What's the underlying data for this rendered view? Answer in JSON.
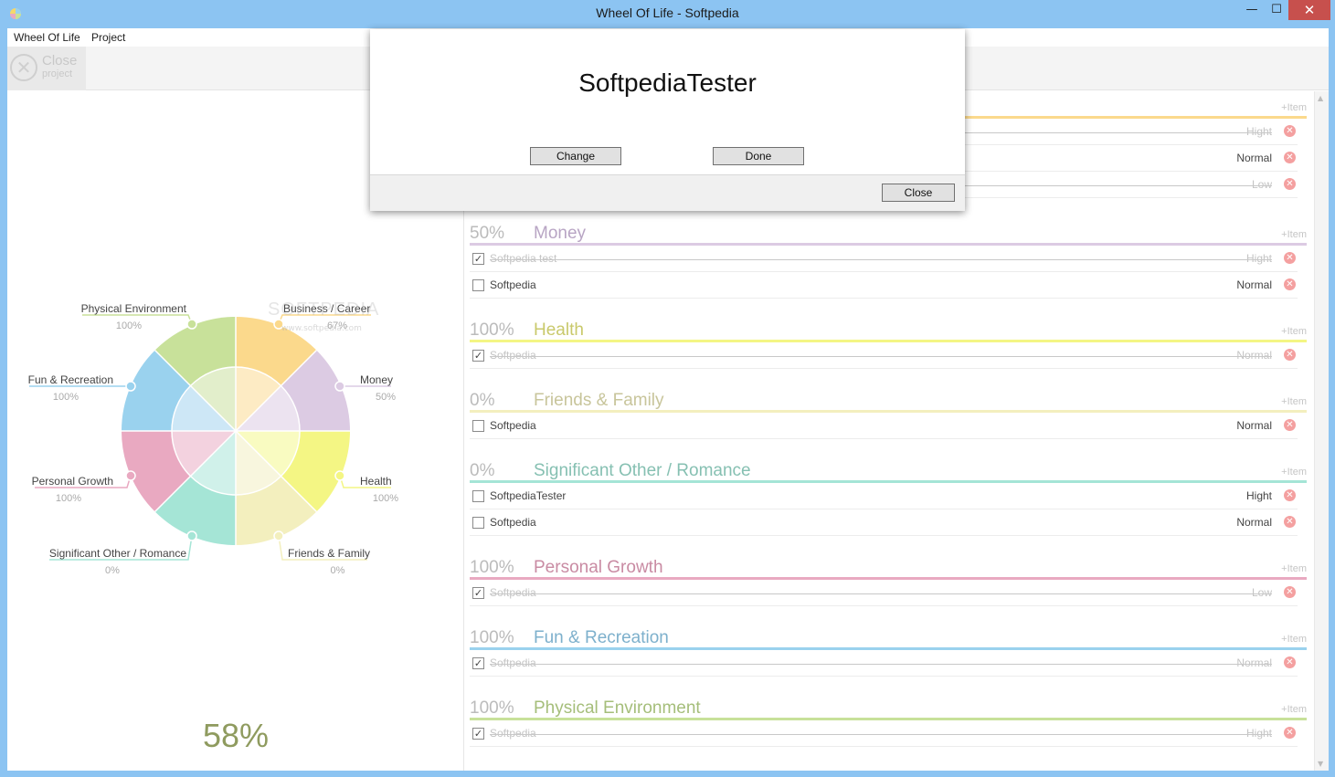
{
  "window": {
    "title": "Wheel Of Life - Softpedia",
    "minimize": "—",
    "maximize": "☐",
    "close": "✕"
  },
  "menu": [
    "Wheel Of Life",
    "Project"
  ],
  "toolbar": {
    "close_label": "Close",
    "close_sub": "project"
  },
  "wheel": {
    "total": "58%",
    "watermark": "SOFTPEDIA",
    "watermark_url": "www.softpedia.com",
    "segments": [
      {
        "name": "Business / Career",
        "pct": "67%",
        "value": 67,
        "color": "#fbd98c",
        "inner": "#fdebc4"
      },
      {
        "name": "Money",
        "pct": "50%",
        "value": 50,
        "color": "#dccbe3",
        "inner": "#ece3f0"
      },
      {
        "name": "Health",
        "pct": "100%",
        "value": 100,
        "color": "#f4f684",
        "inner": "#f9fbc1"
      },
      {
        "name": "Friends & Family",
        "pct": "0%",
        "value": 0,
        "color": "#f3efbe",
        "inner": "#f8f6de"
      },
      {
        "name": "Significant Other / Romance",
        "pct": "0%",
        "value": 0,
        "color": "#a5e5d6",
        "inner": "#d0f1ea"
      },
      {
        "name": "Personal Growth",
        "pct": "100%",
        "value": 100,
        "color": "#e9a9c1",
        "inner": "#f3d2df"
      },
      {
        "name": "Fun & Recreation",
        "pct": "100%",
        "value": 100,
        "color": "#9ad2ee",
        "inner": "#cde7f6"
      },
      {
        "name": "Physical Environment",
        "pct": "100%",
        "value": 100,
        "color": "#c8e19a",
        "inner": "#e2eecb"
      }
    ]
  },
  "categories": [
    {
      "pct": "",
      "name": "",
      "add": "+Item",
      "line": "#fbd98c",
      "name_color": "#c8b070",
      "items": [
        {
          "text": "",
          "priority": "Hight",
          "done": true
        },
        {
          "text": "",
          "priority": "Normal",
          "done": false
        },
        {
          "text": "",
          "priority": "Low",
          "done": true
        }
      ]
    },
    {
      "pct": "50%",
      "name": "Money",
      "add": "+Item",
      "line": "#dccbe3",
      "name_color": "#b8a5c4",
      "items": [
        {
          "text": "Softpedia test",
          "priority": "Hight",
          "done": true
        },
        {
          "text": "Softpedia",
          "priority": "Normal",
          "done": false
        }
      ]
    },
    {
      "pct": "100%",
      "name": "Health",
      "add": "+Item",
      "line": "#f4f684",
      "name_color": "#c9c96b",
      "items": [
        {
          "text": "Softpedia",
          "priority": "Normal",
          "done": true
        }
      ]
    },
    {
      "pct": "0%",
      "name": "Friends & Family",
      "add": "+Item",
      "line": "#f3efbe",
      "name_color": "#c8c59b",
      "items": [
        {
          "text": "Softpedia",
          "priority": "Normal",
          "done": false
        }
      ]
    },
    {
      "pct": "0%",
      "name": "Significant Other / Romance",
      "add": "+Item",
      "line": "#a5e5d6",
      "name_color": "#86c0b2",
      "items": [
        {
          "text": "SoftpediaTester",
          "priority": "Hight",
          "done": false
        },
        {
          "text": "Softpedia",
          "priority": "Normal",
          "done": false
        }
      ]
    },
    {
      "pct": "100%",
      "name": "Personal Growth",
      "add": "+Item",
      "line": "#e9a9c1",
      "name_color": "#c98ba3",
      "items": [
        {
          "text": "Softpedia",
          "priority": "Low",
          "done": true
        }
      ]
    },
    {
      "pct": "100%",
      "name": "Fun & Recreation",
      "add": "+Item",
      "line": "#9ad2ee",
      "name_color": "#7db0cc",
      "items": [
        {
          "text": "Softpedia",
          "priority": "Normal",
          "done": true
        }
      ]
    },
    {
      "pct": "100%",
      "name": "Physical Environment",
      "add": "+Item",
      "line": "#c8e19a",
      "name_color": "#a5be7a",
      "items": [
        {
          "text": "Softpedia",
          "priority": "Hight",
          "done": true
        }
      ]
    }
  ],
  "dialog": {
    "name": "SoftpediaTester",
    "change": "Change",
    "done": "Done",
    "close": "Close"
  }
}
